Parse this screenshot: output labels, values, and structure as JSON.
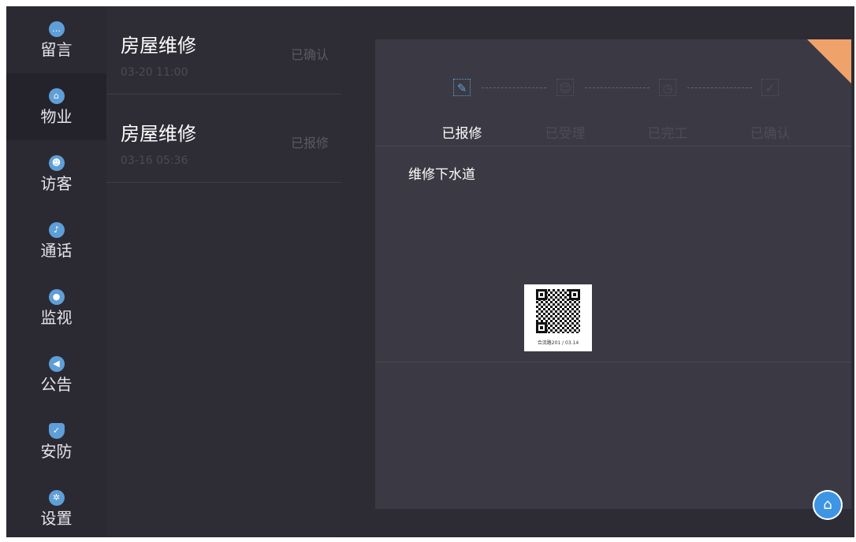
{
  "sidebar": {
    "items": [
      {
        "label": "留言",
        "icon": "message-bubble-icon",
        "glyph": "…"
      },
      {
        "label": "物业",
        "icon": "house-icon",
        "glyph": "⌂"
      },
      {
        "label": "访客",
        "icon": "visitor-icon",
        "glyph": "☻"
      },
      {
        "label": "通话",
        "icon": "microphone-icon",
        "glyph": "♪"
      },
      {
        "label": "监视",
        "icon": "camera-icon",
        "glyph": "●"
      },
      {
        "label": "公告",
        "icon": "megaphone-icon",
        "glyph": "◀"
      },
      {
        "label": "安防",
        "icon": "shield-icon",
        "glyph": "✓"
      },
      {
        "label": "设置",
        "icon": "gear-icon",
        "glyph": "✲"
      }
    ],
    "active_index": 1
  },
  "list": {
    "items": [
      {
        "title": "房屋维修",
        "date": "03-20 11:00",
        "status": "已确认"
      },
      {
        "title": "房屋维修",
        "date": "03-16 05:36",
        "status": "已报修"
      }
    ]
  },
  "detail": {
    "steps": [
      {
        "label": "已报修",
        "icon": "edit-icon",
        "glyph": "✎",
        "active": true
      },
      {
        "label": "已受理",
        "icon": "person-icon",
        "glyph": "☺",
        "active": false
      },
      {
        "label": "已完工",
        "icon": "clock-icon",
        "glyph": "◷",
        "active": false
      },
      {
        "label": "已确认",
        "icon": "check-icon",
        "glyph": "✓",
        "active": false
      }
    ],
    "description": "维修下水道",
    "photo_caption": "合流路201 / 03.14"
  },
  "home_button": {
    "icon": "home-icon",
    "glyph": "⌂"
  },
  "colors": {
    "accent": "#5f9fd8",
    "corner": "#f0a26b",
    "home_button": "#3e95e3"
  }
}
